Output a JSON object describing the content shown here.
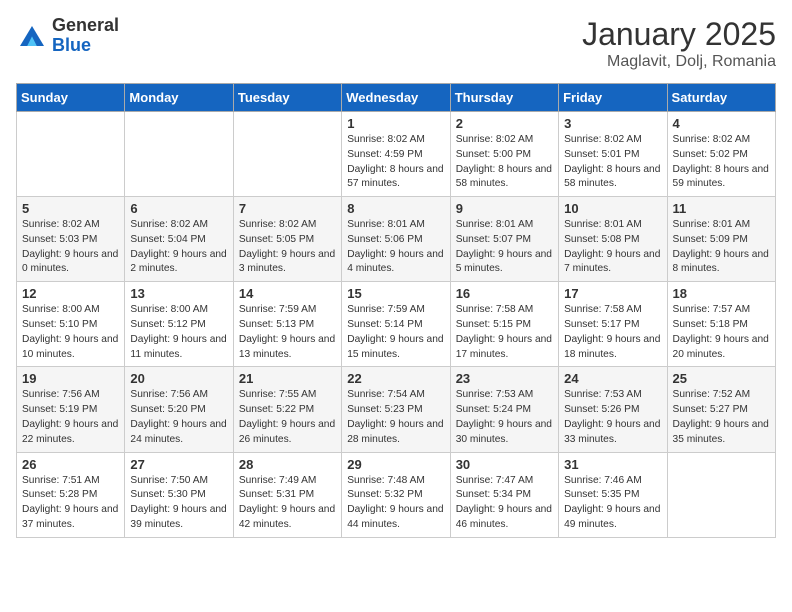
{
  "header": {
    "logo_general": "General",
    "logo_blue": "Blue",
    "title": "January 2025",
    "subtitle": "Maglavit, Dolj, Romania"
  },
  "weekdays": [
    "Sunday",
    "Monday",
    "Tuesday",
    "Wednesday",
    "Thursday",
    "Friday",
    "Saturday"
  ],
  "weeks": [
    [
      {
        "day": "",
        "info": ""
      },
      {
        "day": "",
        "info": ""
      },
      {
        "day": "",
        "info": ""
      },
      {
        "day": "1",
        "info": "Sunrise: 8:02 AM\nSunset: 4:59 PM\nDaylight: 8 hours and 57 minutes."
      },
      {
        "day": "2",
        "info": "Sunrise: 8:02 AM\nSunset: 5:00 PM\nDaylight: 8 hours and 58 minutes."
      },
      {
        "day": "3",
        "info": "Sunrise: 8:02 AM\nSunset: 5:01 PM\nDaylight: 8 hours and 58 minutes."
      },
      {
        "day": "4",
        "info": "Sunrise: 8:02 AM\nSunset: 5:02 PM\nDaylight: 8 hours and 59 minutes."
      }
    ],
    [
      {
        "day": "5",
        "info": "Sunrise: 8:02 AM\nSunset: 5:03 PM\nDaylight: 9 hours and 0 minutes."
      },
      {
        "day": "6",
        "info": "Sunrise: 8:02 AM\nSunset: 5:04 PM\nDaylight: 9 hours and 2 minutes."
      },
      {
        "day": "7",
        "info": "Sunrise: 8:02 AM\nSunset: 5:05 PM\nDaylight: 9 hours and 3 minutes."
      },
      {
        "day": "8",
        "info": "Sunrise: 8:01 AM\nSunset: 5:06 PM\nDaylight: 9 hours and 4 minutes."
      },
      {
        "day": "9",
        "info": "Sunrise: 8:01 AM\nSunset: 5:07 PM\nDaylight: 9 hours and 5 minutes."
      },
      {
        "day": "10",
        "info": "Sunrise: 8:01 AM\nSunset: 5:08 PM\nDaylight: 9 hours and 7 minutes."
      },
      {
        "day": "11",
        "info": "Sunrise: 8:01 AM\nSunset: 5:09 PM\nDaylight: 9 hours and 8 minutes."
      }
    ],
    [
      {
        "day": "12",
        "info": "Sunrise: 8:00 AM\nSunset: 5:10 PM\nDaylight: 9 hours and 10 minutes."
      },
      {
        "day": "13",
        "info": "Sunrise: 8:00 AM\nSunset: 5:12 PM\nDaylight: 9 hours and 11 minutes."
      },
      {
        "day": "14",
        "info": "Sunrise: 7:59 AM\nSunset: 5:13 PM\nDaylight: 9 hours and 13 minutes."
      },
      {
        "day": "15",
        "info": "Sunrise: 7:59 AM\nSunset: 5:14 PM\nDaylight: 9 hours and 15 minutes."
      },
      {
        "day": "16",
        "info": "Sunrise: 7:58 AM\nSunset: 5:15 PM\nDaylight: 9 hours and 17 minutes."
      },
      {
        "day": "17",
        "info": "Sunrise: 7:58 AM\nSunset: 5:17 PM\nDaylight: 9 hours and 18 minutes."
      },
      {
        "day": "18",
        "info": "Sunrise: 7:57 AM\nSunset: 5:18 PM\nDaylight: 9 hours and 20 minutes."
      }
    ],
    [
      {
        "day": "19",
        "info": "Sunrise: 7:56 AM\nSunset: 5:19 PM\nDaylight: 9 hours and 22 minutes."
      },
      {
        "day": "20",
        "info": "Sunrise: 7:56 AM\nSunset: 5:20 PM\nDaylight: 9 hours and 24 minutes."
      },
      {
        "day": "21",
        "info": "Sunrise: 7:55 AM\nSunset: 5:22 PM\nDaylight: 9 hours and 26 minutes."
      },
      {
        "day": "22",
        "info": "Sunrise: 7:54 AM\nSunset: 5:23 PM\nDaylight: 9 hours and 28 minutes."
      },
      {
        "day": "23",
        "info": "Sunrise: 7:53 AM\nSunset: 5:24 PM\nDaylight: 9 hours and 30 minutes."
      },
      {
        "day": "24",
        "info": "Sunrise: 7:53 AM\nSunset: 5:26 PM\nDaylight: 9 hours and 33 minutes."
      },
      {
        "day": "25",
        "info": "Sunrise: 7:52 AM\nSunset: 5:27 PM\nDaylight: 9 hours and 35 minutes."
      }
    ],
    [
      {
        "day": "26",
        "info": "Sunrise: 7:51 AM\nSunset: 5:28 PM\nDaylight: 9 hours and 37 minutes."
      },
      {
        "day": "27",
        "info": "Sunrise: 7:50 AM\nSunset: 5:30 PM\nDaylight: 9 hours and 39 minutes."
      },
      {
        "day": "28",
        "info": "Sunrise: 7:49 AM\nSunset: 5:31 PM\nDaylight: 9 hours and 42 minutes."
      },
      {
        "day": "29",
        "info": "Sunrise: 7:48 AM\nSunset: 5:32 PM\nDaylight: 9 hours and 44 minutes."
      },
      {
        "day": "30",
        "info": "Sunrise: 7:47 AM\nSunset: 5:34 PM\nDaylight: 9 hours and 46 minutes."
      },
      {
        "day": "31",
        "info": "Sunrise: 7:46 AM\nSunset: 5:35 PM\nDaylight: 9 hours and 49 minutes."
      },
      {
        "day": "",
        "info": ""
      }
    ]
  ]
}
